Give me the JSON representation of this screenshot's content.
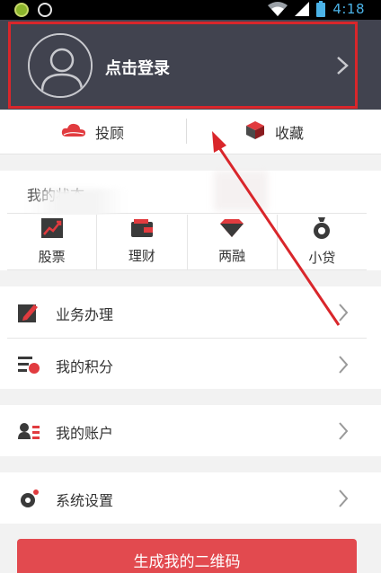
{
  "status_bar": {
    "time": "4:18",
    "icons": [
      "app-icon",
      "cat-icon",
      "wifi-icon",
      "signal-icon",
      "battery-icon"
    ]
  },
  "header": {
    "login_label": "点击登录",
    "avatar_icon": "user-avatar-icon",
    "highlight_color": "#d9262b"
  },
  "quick_actions": [
    {
      "label": "投顾",
      "icon": "cloud-icon"
    },
    {
      "label": "收藏",
      "icon": "cube-icon"
    }
  ],
  "status_section": {
    "title": "我的状态"
  },
  "grid": [
    {
      "label": "股票",
      "icon": "stock-chart-icon"
    },
    {
      "label": "理财",
      "icon": "wallet-icon"
    },
    {
      "label": "两融",
      "icon": "diamond-icon"
    },
    {
      "label": "小贷",
      "icon": "money-bag-icon"
    }
  ],
  "menu": [
    {
      "label": "业务办理",
      "icon": "edit-icon"
    },
    {
      "label": "我的积分",
      "icon": "points-icon"
    },
    {
      "label": "我的账户",
      "icon": "account-icon"
    },
    {
      "label": "系统设置",
      "icon": "settings-gear-icon"
    }
  ],
  "qr_button": {
    "label": "生成我的二维码"
  },
  "colors": {
    "header_bg": "#41434f",
    "accent_red": "#e24a4f",
    "status_blue": "#4bb3e8"
  }
}
